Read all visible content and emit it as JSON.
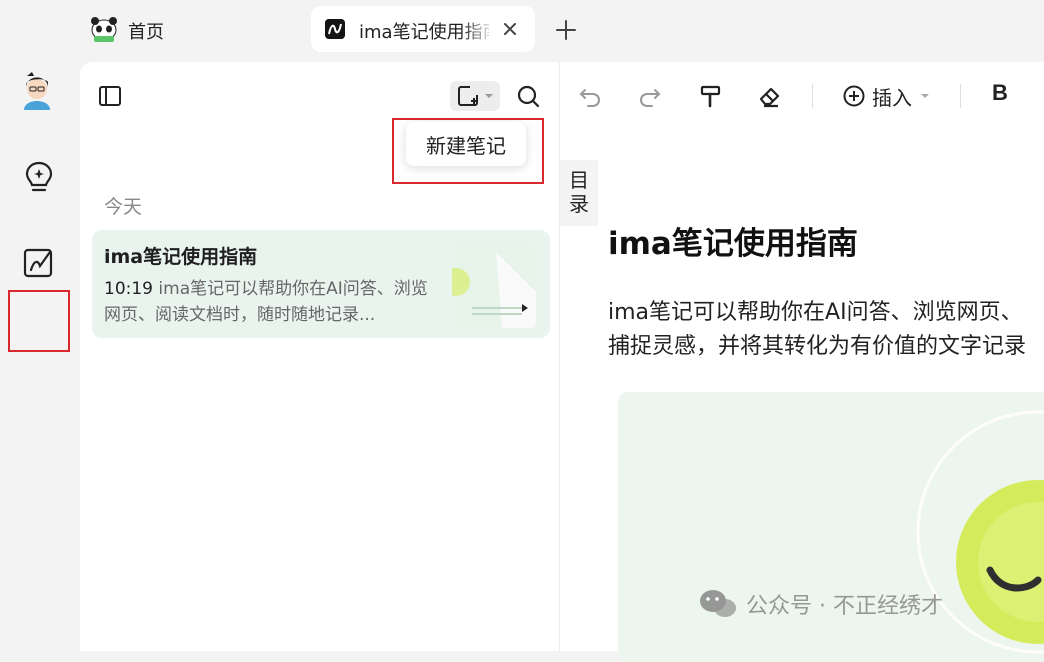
{
  "tabs": [
    {
      "label": "首页",
      "icon": "panda-icon"
    },
    {
      "label": "ima笔记使用指南",
      "icon": "note-app-icon",
      "active": true
    }
  ],
  "note_list": {
    "tooltip": "新建笔记",
    "group_label": "今天",
    "notes": [
      {
        "title": "ima笔记使用指南",
        "time": "10:19",
        "snippet": "ima笔记可以帮助你在AI问答、浏览网页、阅读文档时，随时随地记录..."
      }
    ]
  },
  "editor": {
    "insert_label": "插入",
    "bold_label": "B",
    "toc_label": "目录",
    "title": "ima笔记使用指南",
    "body_line1": "ima笔记可以帮助你在AI问答、浏览网页、",
    "body_line2": "捕捉灵感，并将其转化为有价值的文字记录"
  },
  "watermark": "公众号 · 不正经绣才",
  "colors": {
    "accent_red": "#d9272e",
    "card_bg": "#e9f4ee",
    "app_bg": "#f3f3f3"
  }
}
